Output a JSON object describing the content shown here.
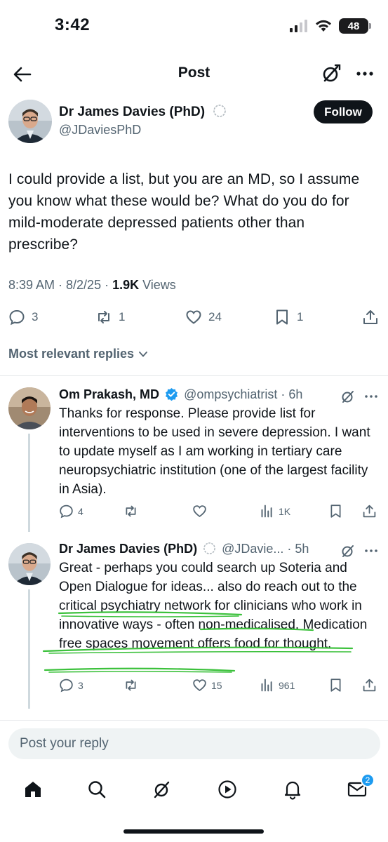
{
  "status": {
    "time": "3:42",
    "battery": "48"
  },
  "nav": {
    "title": "Post"
  },
  "post": {
    "author_name": "Dr James Davies (PhD)",
    "author_handle": "@JDaviesPhD",
    "follow_label": "Follow",
    "text": "I could provide a list, but you are an MD, so I assume you know what these would be? What do you do for mild-moderate depressed patients other than prescribe?",
    "timestamp": "8:39 AM · 8/2/25 · ",
    "views_count": "1.9K",
    "views_label": " Views",
    "replies": "3",
    "reposts": "1",
    "likes": "24",
    "bookmarks": "1"
  },
  "replies_header": "Most relevant replies",
  "replies": [
    {
      "name": "Om Prakash, MD",
      "meta": "@ompsychiatrist · 6h",
      "text": "Thanks for response. Please provide list for interventions to be used in severe depression. I want to update myself as I am working in tertiary care neuropsychiatric institution (one of the largest facility in Asia).",
      "replies": "4",
      "reposts": "",
      "likes": "",
      "views": "1K"
    },
    {
      "name": "Dr James Davies (PhD)",
      "meta": "@JDavie... · 5h",
      "text": "Great - perhaps you could search up Soteria and Open Dialogue for ideas... also do reach out to the critical psychiatry network for clinicians who work in innovative ways - often non-medicalised. Medication free spaces movement offers food for thought.",
      "replies": "3",
      "reposts": "",
      "likes": "15",
      "views": "961"
    }
  ],
  "compose": {
    "placeholder": "Post your reply"
  },
  "tabbar": {
    "messages_badge": "2"
  },
  "colors": {
    "accent": "#1d9bf0",
    "annotation": "#3cc13c",
    "text": "#0f1419",
    "secondary": "#536471"
  }
}
